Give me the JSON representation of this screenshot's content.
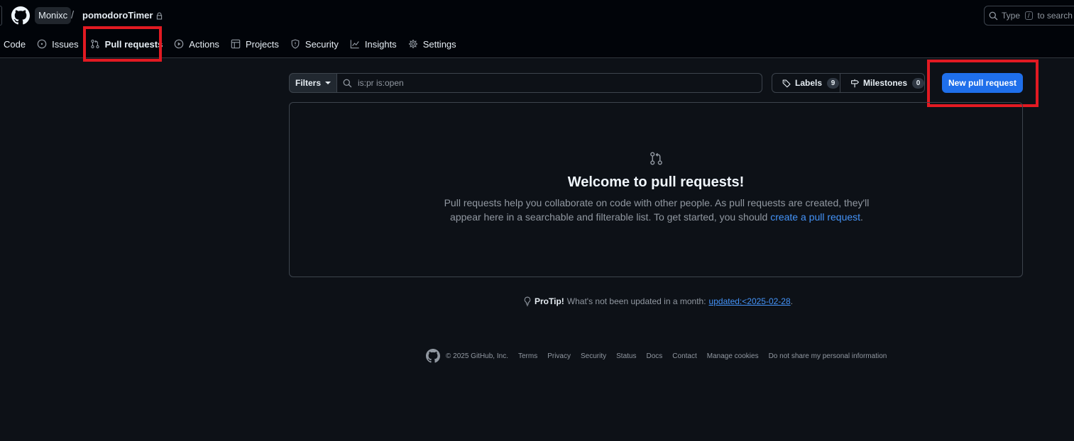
{
  "header": {
    "owner": "Monixc",
    "separator": "/",
    "repo": "pomodoroTimer",
    "search": {
      "prefix": "Type",
      "key": "/",
      "suffix": "to search"
    }
  },
  "tabs": [
    {
      "label": "Code",
      "icon": "code-icon"
    },
    {
      "label": "Issues",
      "icon": "issue-opened-icon"
    },
    {
      "label": "Pull requests",
      "icon": "git-pull-request-icon",
      "active": true
    },
    {
      "label": "Actions",
      "icon": "play-icon"
    },
    {
      "label": "Projects",
      "icon": "table-icon"
    },
    {
      "label": "Security",
      "icon": "shield-icon"
    },
    {
      "label": "Insights",
      "icon": "graph-icon"
    },
    {
      "label": "Settings",
      "icon": "gear-icon"
    }
  ],
  "toolbar": {
    "filters_label": "Filters",
    "filter_value": "is:pr is:open",
    "labels_label": "Labels",
    "labels_count": "9",
    "milestones_label": "Milestones",
    "milestones_count": "0",
    "new_pr_label": "New pull request"
  },
  "blankslate": {
    "title": "Welcome to pull requests!",
    "line1": "Pull requests help you collaborate on code with other people. As pull requests are created, they'll",
    "line2_prefix": "appear here in a searchable and filterable list. To get started, you should ",
    "link": "create a pull request",
    "line2_suffix": "."
  },
  "protip": {
    "strong": "ProTip!",
    "text": " What's not been updated in a month: ",
    "link": "updated:<2025-02-28",
    "suffix": "."
  },
  "footer": {
    "copyright": "© 2025 GitHub, Inc.",
    "links": [
      "Terms",
      "Privacy",
      "Security",
      "Status",
      "Docs",
      "Contact",
      "Manage cookies",
      "Do not share my personal information"
    ]
  },
  "colors": {
    "background": "#0d1117",
    "header_background": "#010409",
    "accent": "#1f6feb",
    "link": "#4493f8",
    "highlight": "#e21a22"
  }
}
